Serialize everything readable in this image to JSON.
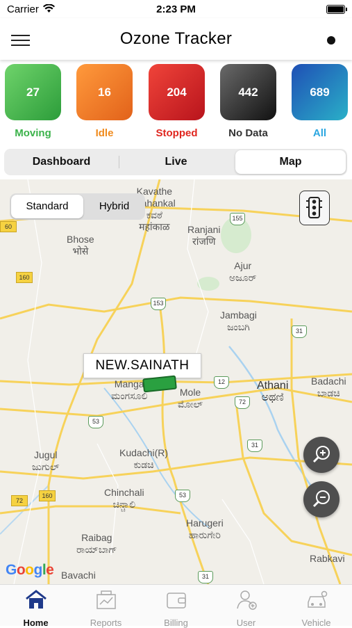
{
  "status_bar": {
    "carrier": "Carrier",
    "time": "2:23 PM"
  },
  "app": {
    "title": "Ozone Tracker"
  },
  "summary": [
    {
      "count": "27",
      "label": "Moving",
      "color": "#3bb24a"
    },
    {
      "count": "16",
      "label": "Idle",
      "color": "#f08a1c"
    },
    {
      "count": "204",
      "label": "Stopped",
      "color": "#e0261f"
    },
    {
      "count": "442",
      "label": "No Data",
      "color": "#333333"
    },
    {
      "count": "689",
      "label": "All",
      "color": "#2aa6e0"
    }
  ],
  "view_tabs": {
    "items": [
      "Dashboard",
      "Live",
      "Map"
    ],
    "selected": "Map"
  },
  "map": {
    "type_toggle": {
      "standard": "Standard",
      "hybrid": "Hybrid",
      "selected": "Standard"
    },
    "vehicle_label": "NEW.SAINATH",
    "attribution": "Google",
    "places": [
      {
        "name": "Kavathe\nMahankal",
        "native": "ಕವಠೆ\nमहांकाळ"
      },
      {
        "name": "Ranjani",
        "native": "रांजणि"
      },
      {
        "name": "Bhose",
        "native": "भोसे"
      },
      {
        "name": "Ajur",
        "native": "ಅಜೂರ್"
      },
      {
        "name": "Jambagi",
        "native": "ಜಂಬಗಿ"
      },
      {
        "name": "Athani",
        "native": "ಅಥಣಿ"
      },
      {
        "name": "Badachi",
        "native": "ಬಾಡಚಿ"
      },
      {
        "name": "Mangasuli",
        "native": "ಮಂಗಸೂಲಿ"
      },
      {
        "name": "Mole",
        "native": "ಮೋಲ್"
      },
      {
        "name": "Jugul",
        "native": "ಜುಗುಲ್"
      },
      {
        "name": "Kudachi(R)",
        "native": "ಕುಡಚಿ"
      },
      {
        "name": "Chinchali",
        "native": "ಚಿನ್ಚಾಲಿ"
      },
      {
        "name": "Raibag",
        "native": "ರಾಯ್‌ಬಾಗ್"
      },
      {
        "name": "Harugeri",
        "native": "ಹಾರುಗೇರಿ"
      },
      {
        "name": "Rabkavi",
        "native": ""
      },
      {
        "name": "Bavachi",
        "native": ""
      }
    ],
    "highway_shields": [
      "155",
      "153",
      "31",
      "12",
      "72",
      "53",
      "31",
      "53",
      "31"
    ],
    "state_shields": [
      "60",
      "160",
      "160",
      "72"
    ]
  },
  "bottom_tabs": [
    "Home",
    "Reports",
    "Billing",
    "User",
    "Vehicle"
  ],
  "bottom_tab_selected": "Home"
}
